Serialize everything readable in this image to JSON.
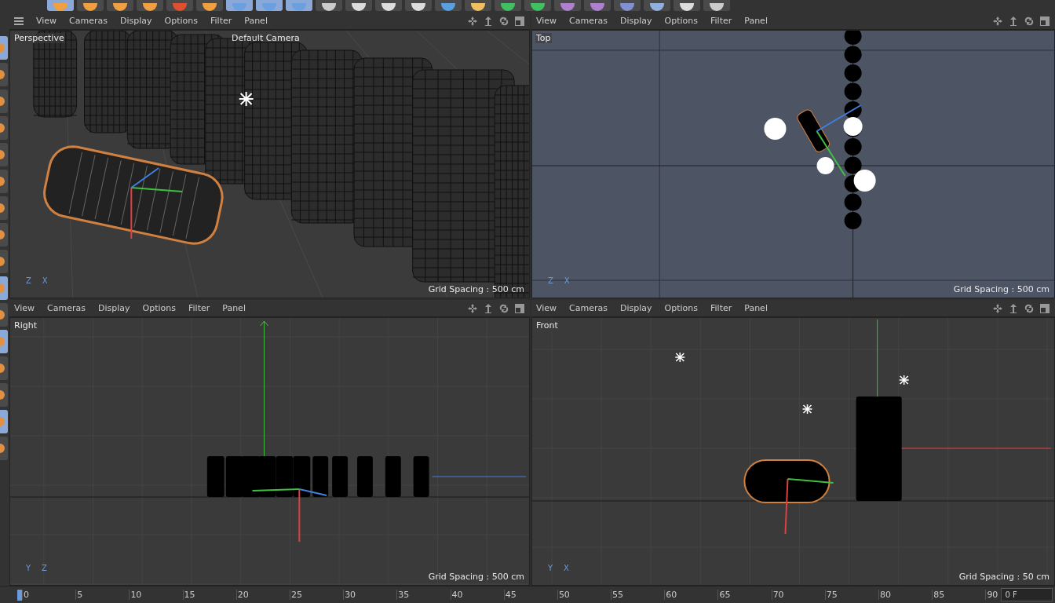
{
  "viewports": [
    {
      "kind": "perspective",
      "label": "Perspective",
      "camera": "Default Camera",
      "menu_button": true,
      "menu": [
        "View",
        "Cameras",
        "Display",
        "Options",
        "Filter",
        "Panel"
      ],
      "axes": [
        "Z",
        "X"
      ],
      "grid_spacing": "Grid Spacing : 500 cm"
    },
    {
      "kind": "top",
      "label": "Top",
      "menu_button": false,
      "menu": [
        "View",
        "Cameras",
        "Display",
        "Options",
        "Filter",
        "Panel"
      ],
      "axes": [
        "Z",
        "X"
      ],
      "grid_spacing": "Grid Spacing : 500 cm"
    },
    {
      "kind": "right",
      "label": "Right",
      "menu_button": false,
      "menu": [
        "View",
        "Cameras",
        "Display",
        "Options",
        "Filter",
        "Panel"
      ],
      "axes": [
        "Y",
        "Z"
      ],
      "grid_spacing": "Grid Spacing : 500 cm"
    },
    {
      "kind": "front",
      "label": "Front",
      "menu_button": false,
      "menu": [
        "View",
        "Cameras",
        "Display",
        "Options",
        "Filter",
        "Panel"
      ],
      "axes": [
        "Y",
        "X"
      ],
      "grid_spacing": "Grid Spacing : 50 cm"
    }
  ],
  "timeline": {
    "ticks": [
      "0",
      "5",
      "10",
      "15",
      "20",
      "25",
      "30",
      "35",
      "40",
      "45",
      "50",
      "55",
      "60",
      "65",
      "70",
      "75",
      "80",
      "85",
      "90"
    ],
    "frame": "0 F"
  }
}
